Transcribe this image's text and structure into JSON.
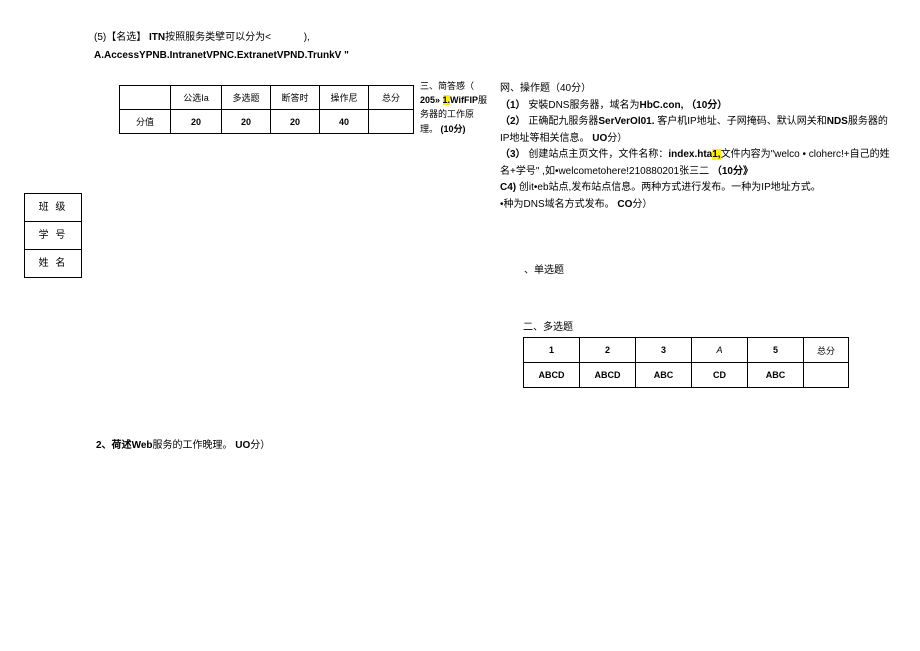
{
  "q5": {
    "line1_a": "(5)【名选】",
    "line1_b": "ITN",
    "line1_c": "按照服务类擘可以分为<",
    "line1_d": "),",
    "line2": "A.AccessYPNB.IntranetVPNC.ExtranetVPND.TrunkV \""
  },
  "score_table": {
    "h1": "公选Ia",
    "h2": "多选题",
    "h3": "断答时",
    "h4": "操作尼",
    "h5": "总分",
    "r1c1": "分值",
    "r1c2": "20",
    "r1c3": "20",
    "r1c4": "20",
    "r1c5": "40",
    "r1c6": ""
  },
  "sect3": {
    "text_a": "三、简答感（",
    "text_b_pre": "205» ",
    "text_b_hl": "1.",
    "text_b_post": "WifFIP",
    "text_c": "服务器的工作原理。",
    "text_d": "(10分)"
  },
  "strip": {
    "r1": "班 级",
    "r2": "学 号",
    "r3": "姓 名"
  },
  "right": {
    "l1": "网、操作题（40分）",
    "l2_a": "（1）",
    "l2_b": "安裝DNS服务器，域名为",
    "l2_c": "HbC.con,",
    "l2_d": "（10分）",
    "l3_a": "（2）",
    "l3_b": "正确配九服务器",
    "l3_c": "SerVerOl01.",
    "l3_d": "客户机IP地址、子网掩码、默认网关和",
    "l3_e": "NDS",
    "l3_f": "服务器的IP地址等相关信息。",
    "l3_g": "UO",
    "l3_h": "分）",
    "l4_a": "（3）",
    "l4_b": "创建站点主页文件，文件名称：",
    "l4_c": "index.hta",
    "l4_hl": "1,",
    "l4_d": "文件内容为\"welco • cloherc!+自己的姓名+学号\" ,如•welcometohere!210880201",
    "l4_e": "张三二",
    "l4_f": "（10分》",
    "l5_a": "C4)",
    "l5_b": "创it•eb站点,发布站点信息。两种方式进行发布。一种为IP地址方式。",
    "l6_a": "•种为DNS域名方式发布。",
    "l6_b": "CO",
    "l6_c": "分）"
  },
  "single": "、单选题",
  "multi_h": "二、多选题",
  "multi_table": {
    "h1": "1",
    "h2": "2",
    "h3": "3",
    "h4": "A",
    "h5": "5",
    "h6": "总分",
    "r1": "ABCD",
    "r2": "ABCD",
    "r3": "ABC",
    "r4": "CD",
    "r5": "ABC",
    "r6": ""
  },
  "q2_a": "2、荷述",
  "q2_b": "Web",
  "q2_c": "服务的工作晚理。",
  "q2_d": "UO",
  "q2_e": "分）"
}
